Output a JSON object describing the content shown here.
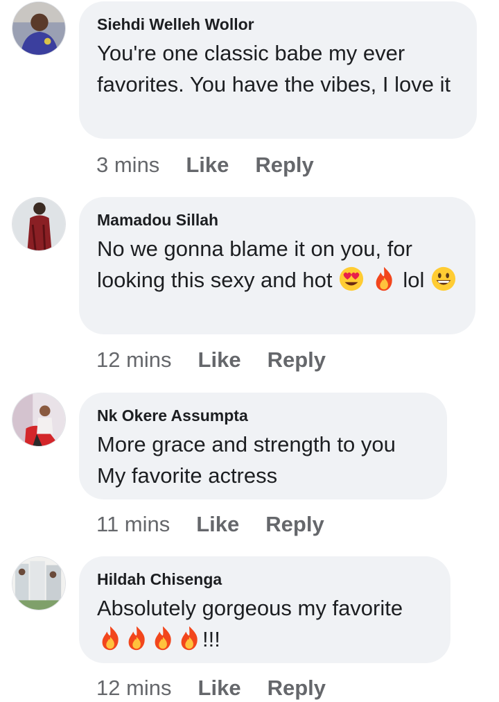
{
  "comments": [
    {
      "author": "Siehdi Welleh Wollor",
      "text": "You're one classic babe my ever favorites. You have the vibes, I love it",
      "time": "3 mins",
      "like": "Like",
      "reply": "Reply"
    },
    {
      "author": "Mamadou Sillah",
      "text_part1": "No we gonna blame it on you, for looking this sexy and hot",
      "text_part2": "lol",
      "emojis": [
        "heart-eyes-emoji",
        "fire-emoji",
        "grinning-emoji"
      ],
      "time": "12 mins",
      "like": "Like",
      "reply": "Reply"
    },
    {
      "author": "Nk Okere Assumpta",
      "text": "More grace and strength to you My favorite actress",
      "time": "11 mins",
      "like": "Like",
      "reply": "Reply"
    },
    {
      "author": "Hildah Chisenga",
      "text": "Absolutely gorgeous my favorite",
      "suffix": "!!!",
      "emojis": [
        "fire-emoji",
        "fire-emoji",
        "fire-emoji",
        "fire-emoji"
      ],
      "time": "12 mins",
      "like": "Like",
      "reply": "Reply"
    }
  ],
  "colors": {
    "bubble": "#f0f2f5",
    "text": "#1c1e21",
    "meta": "#65676b"
  }
}
